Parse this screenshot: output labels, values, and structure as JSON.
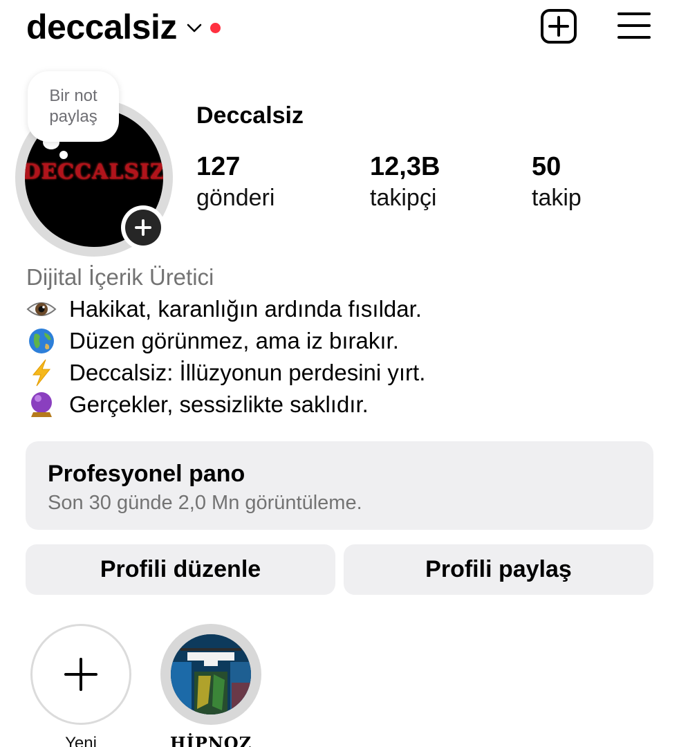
{
  "header": {
    "username": "deccalsiz",
    "new_post_icon": "plus-square-icon",
    "menu_icon": "hamburger-menu-icon",
    "notification_dot_color": "#ff3040"
  },
  "avatar": {
    "note_line1": "Bir not",
    "note_line2": "paylaş",
    "logo_text": "DECCALSIZ"
  },
  "profile": {
    "display_name": "Deccalsiz",
    "stats": [
      {
        "value": "127",
        "label": "gönderi"
      },
      {
        "value": "12,3B",
        "label": "takipçi"
      },
      {
        "value": "50",
        "label": "takip"
      }
    ]
  },
  "bio": {
    "category": "Dijital İçerik Üretici",
    "lines": [
      {
        "icon": "eye-icon",
        "text": "Hakikat, karanlığın ardında fısıldar."
      },
      {
        "icon": "globe-icon",
        "text": "Düzen görünmez, ama iz bırakır."
      },
      {
        "icon": "lightning-icon",
        "text": "Deccalsiz: İllüzyonun perdesini yırt."
      },
      {
        "icon": "crystal-ball-icon",
        "text": "Gerçekler, sessizlikte saklıdır."
      }
    ]
  },
  "pro_panel": {
    "title": "Profesyonel pano",
    "subtitle": "Son 30 günde 2,0 Mn görüntüleme."
  },
  "buttons": {
    "edit": "Profili düzenle",
    "share": "Profili paylaş"
  },
  "highlights": [
    {
      "label": "Yeni",
      "icon": "plus-icon"
    },
    {
      "label": "HİPNOZ"
    }
  ]
}
